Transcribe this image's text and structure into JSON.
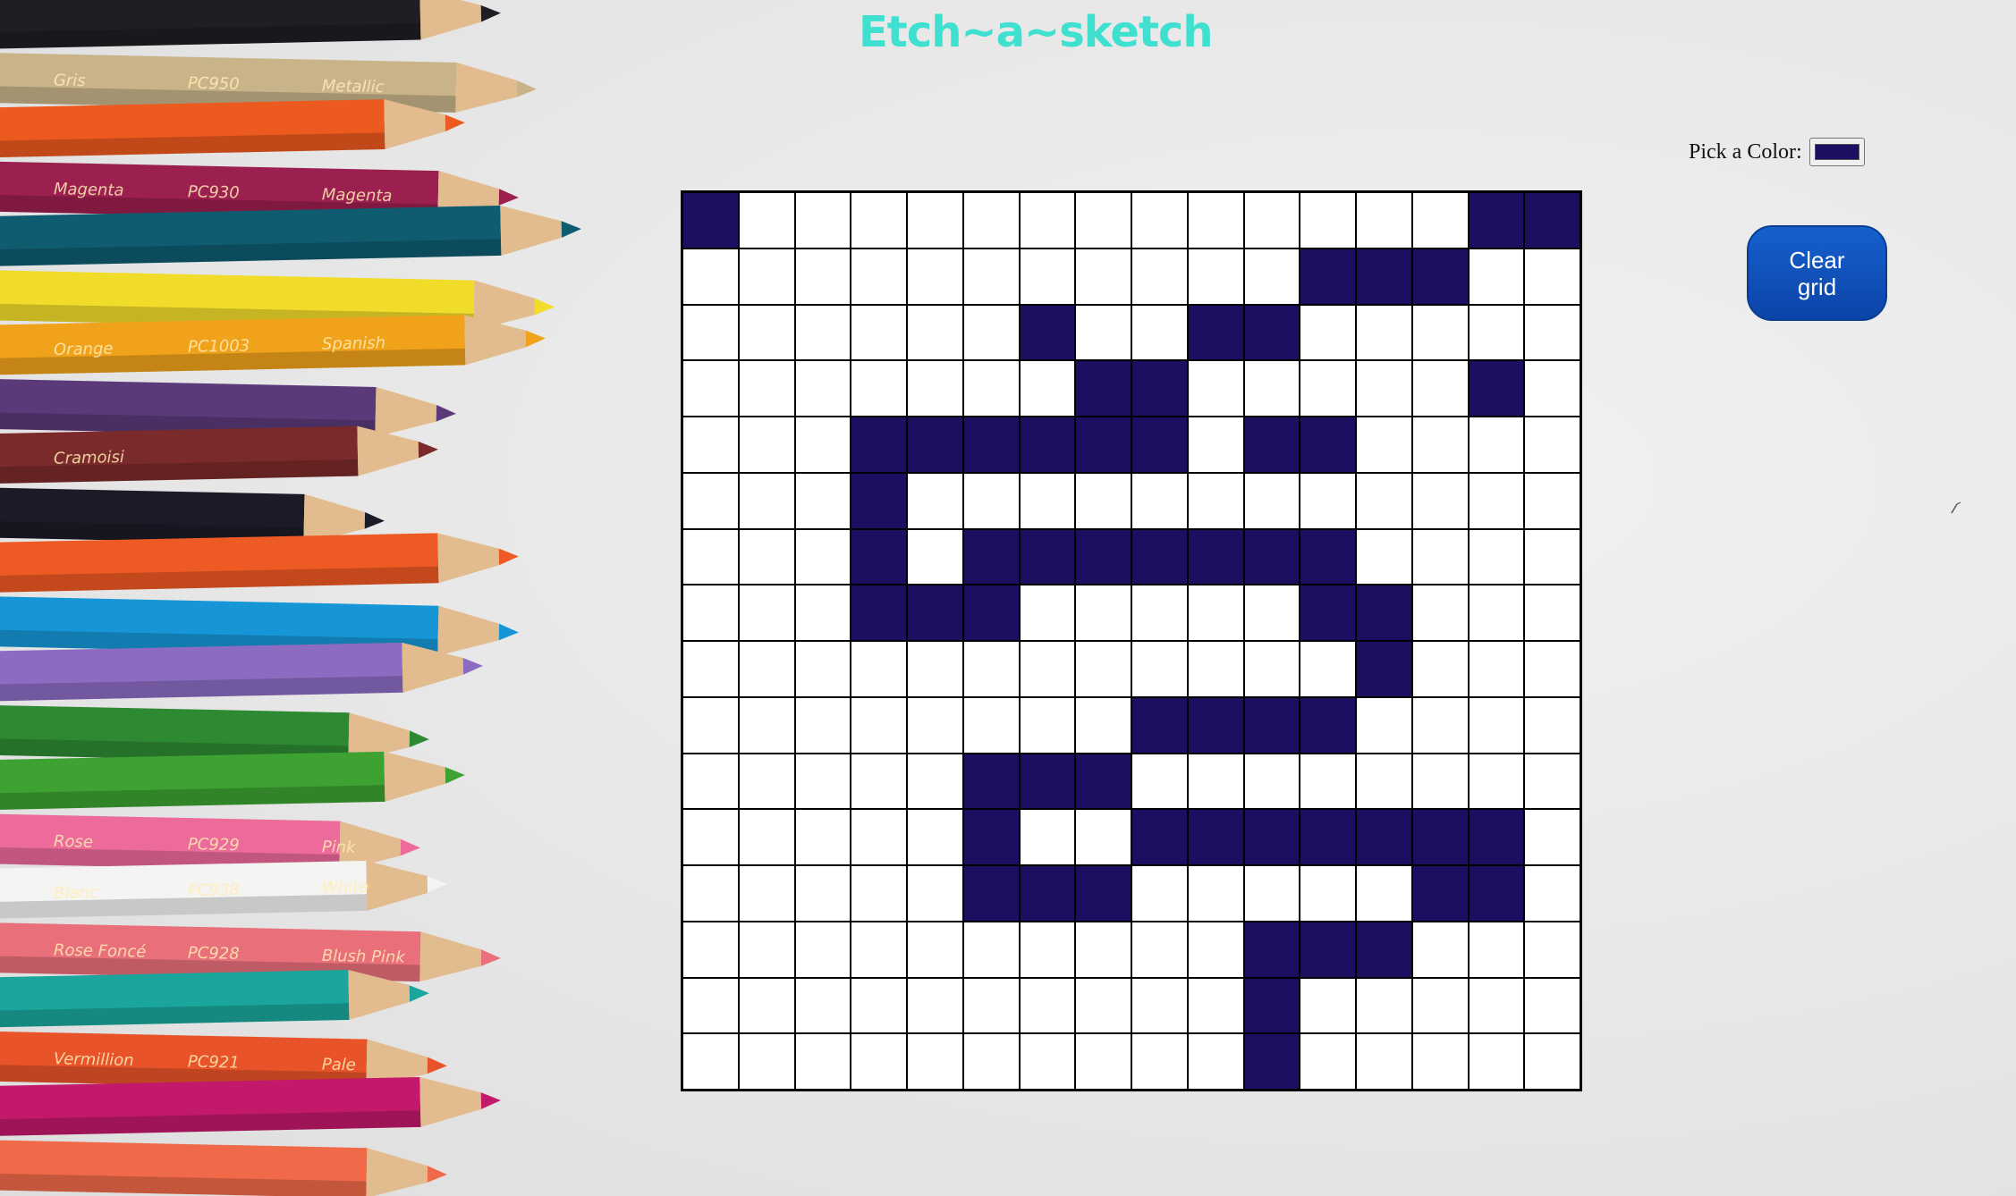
{
  "app": {
    "title": "Etch~a~sketch"
  },
  "controls": {
    "color_label": "Pick a Color:",
    "color_value": "#1c0f62",
    "clear_button_label": "Clear\ngrid"
  },
  "colors": {
    "title": "#40e0d0",
    "fill": "#1c0f62",
    "empty": "#ffffff",
    "button": "#0b44a8"
  },
  "grid": {
    "size": 16,
    "rows": [
      "1000000000000011",
      "0000000000011100",
      "0000001001100000",
      "0000000110000010",
      "0001111110110000",
      "0001000000000000",
      "0001011111110000",
      "0001110000011000",
      "0000000000001000",
      "0000000011110000",
      "0000011100000000",
      "0000010011111110",
      "0000011100000110",
      "0000000000111000",
      "0000000000100000",
      "0000000000100000"
    ]
  },
  "decor": {
    "background_image": "colored-pencils-photo",
    "pencils": [
      {
        "color": "#1e1e24"
      },
      {
        "color": "#c9b48a",
        "text": [
          "Gris",
          "PC950",
          "Metallic"
        ]
      },
      {
        "color": "#ec5a1f"
      },
      {
        "color": "#9b1f4f",
        "text": [
          "Magenta",
          "PC930",
          "Magenta"
        ]
      },
      {
        "color": "#0f5c70"
      },
      {
        "color": "#f2dc2a"
      },
      {
        "color": "#f0a21b",
        "text": [
          "Orange",
          "PC1003",
          "Spanish"
        ]
      },
      {
        "color": "#5b3a7a"
      },
      {
        "color": "#7a2a2a",
        "text": [
          "Cramoisi"
        ]
      },
      {
        "color": "#1b1b28"
      },
      {
        "color": "#ee5a24"
      },
      {
        "color": "#1696d6"
      },
      {
        "color": "#8c6cc2"
      },
      {
        "color": "#2e8a32"
      },
      {
        "color": "#3ea233"
      },
      {
        "color": "#ec6b9a",
        "text": [
          "Rose",
          "PC929",
          "Pink"
        ]
      },
      {
        "color": "#f4f4f2",
        "text": [
          "Blanc",
          "PC938",
          "White"
        ]
      },
      {
        "color": "#e9707a",
        "text": [
          "Rose Foncé",
          "PC928",
          "Blush Pink"
        ]
      },
      {
        "color": "#1aa69c"
      },
      {
        "color": "#e8532a",
        "text": [
          "Vermillion",
          "PC921",
          "Pale"
        ]
      },
      {
        "color": "#c3196a"
      },
      {
        "color": "#f06a4a"
      }
    ]
  }
}
